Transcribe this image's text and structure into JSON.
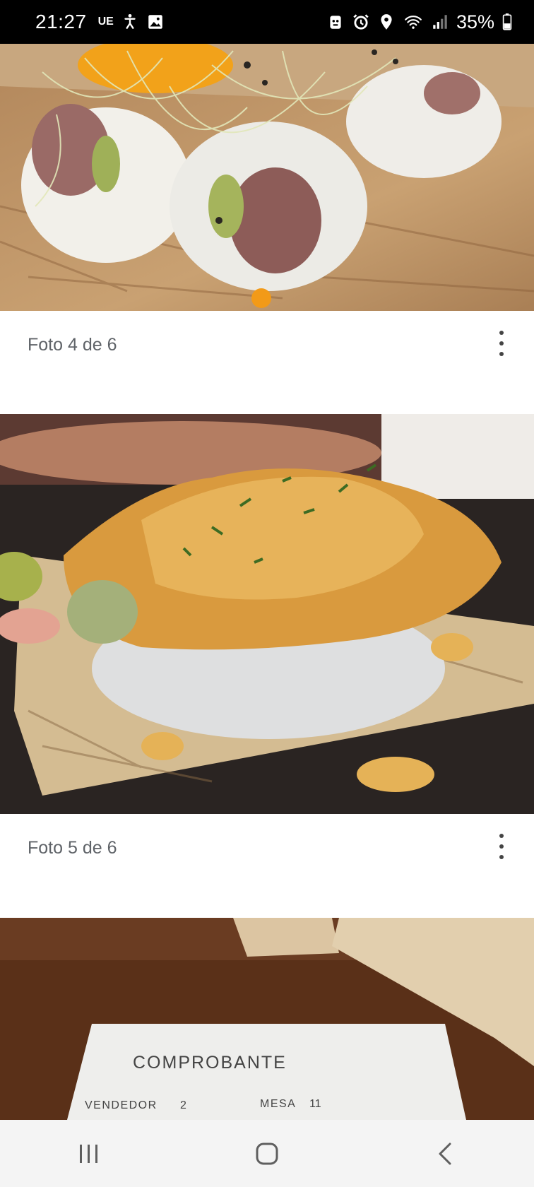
{
  "status_bar": {
    "time": "21:27",
    "carrier": "UE",
    "battery": "35%",
    "icons_left": [
      "accessibility-icon",
      "gallery-notification-icon"
    ],
    "icons_right": [
      "android-auto-icon",
      "alarm-icon",
      "location-icon",
      "wifi-icon",
      "signal-icon",
      "battery-icon"
    ]
  },
  "gallery": {
    "photos": [
      {
        "caption": "Foto 4 de 6",
        "subject": "sushi roll with tuna and sprouts"
      },
      {
        "caption": "Foto 5 de 6",
        "subject": "sushi topped with tempura shrimp and sauce"
      },
      {
        "receipt": {
          "title": "COMPROBANTE",
          "seller_label": "VENDEDOR",
          "seller_value": "2",
          "table_label": "MESA",
          "table_value": "11"
        }
      }
    ]
  },
  "nav_bar": {
    "buttons": [
      "recents-button",
      "home-button",
      "back-button"
    ]
  },
  "colors": {
    "status_bg": "#000000",
    "caption_text": "#5f6368",
    "nav_bg": "#f4f4f4"
  }
}
